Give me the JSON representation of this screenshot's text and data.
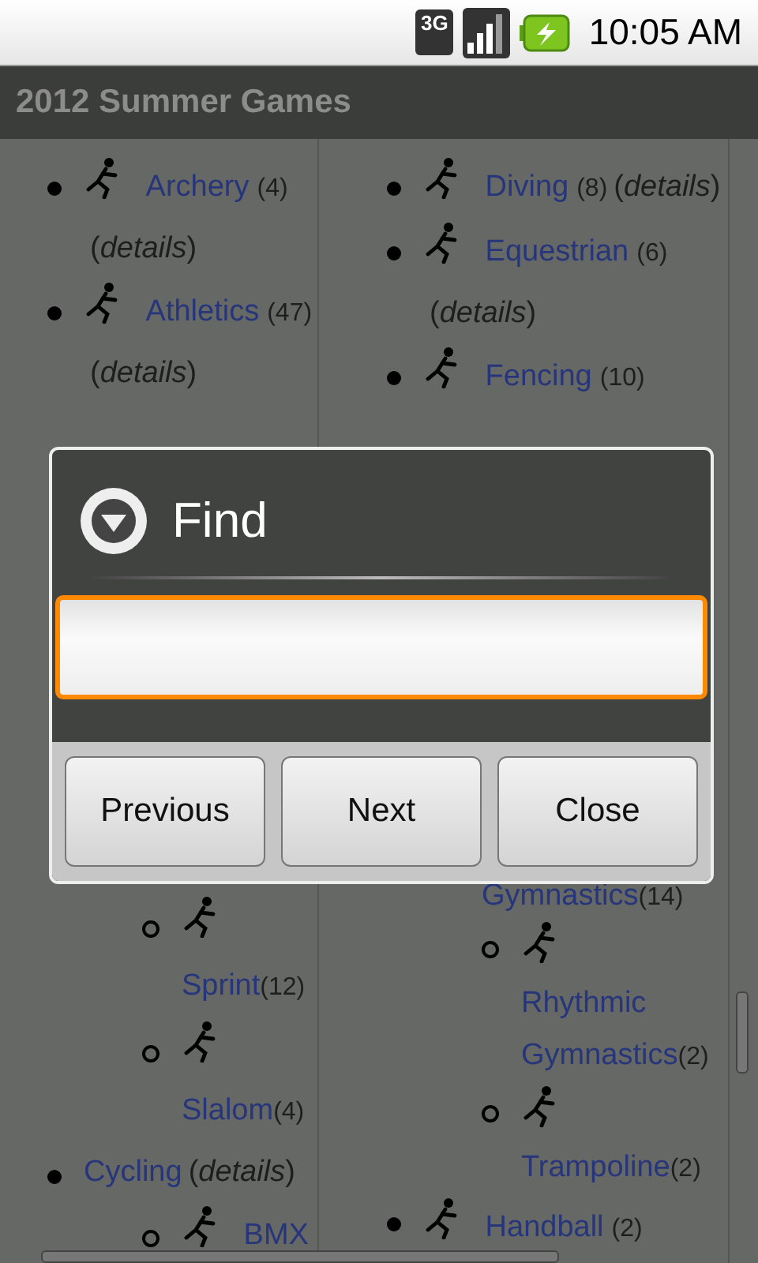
{
  "status_bar": {
    "network": "3G",
    "time": "10:05 AM"
  },
  "title_bar": {
    "title": "2012 Summer Games"
  },
  "columns": [
    {
      "top": [
        {
          "kind": "sport",
          "name": "Archery",
          "count": "(4)",
          "details": "(*details*)"
        },
        {
          "kind": "sport",
          "name": "Athletics",
          "count": "(47)",
          "details": "(*details*)"
        }
      ],
      "bottom": [
        {
          "kind": "event",
          "name": "Sprint",
          "count": "(12)"
        },
        {
          "kind": "event",
          "name": "Slalom",
          "count": "(4)"
        },
        {
          "kind": "group",
          "name": "Cycling",
          "details": "(*details*)"
        },
        {
          "kind": "event",
          "name": "BMX"
        }
      ]
    },
    {
      "top": [
        {
          "kind": "sport",
          "name": "Diving",
          "count": "(8)",
          "details": "(*details*)"
        },
        {
          "kind": "sport",
          "name": "Equestrian",
          "count": "(6)",
          "details": "(*details*)"
        },
        {
          "kind": "sport",
          "name": "Fencing",
          "count": "(10)"
        }
      ],
      "bottom": [
        {
          "kind": "tail",
          "name": "Gymnastics",
          "count": "(14)"
        },
        {
          "kind": "event",
          "name": "Rhythmic Gymnastics",
          "count": "(2)"
        },
        {
          "kind": "event",
          "name": "Trampoline",
          "count": "(2)"
        },
        {
          "kind": "sport",
          "name": "Handball",
          "count": "(2)"
        }
      ]
    }
  ],
  "dialog": {
    "title": "Find",
    "field": {
      "focused": true
    },
    "buttons": [
      "Previous",
      "Next",
      "Close"
    ]
  }
}
